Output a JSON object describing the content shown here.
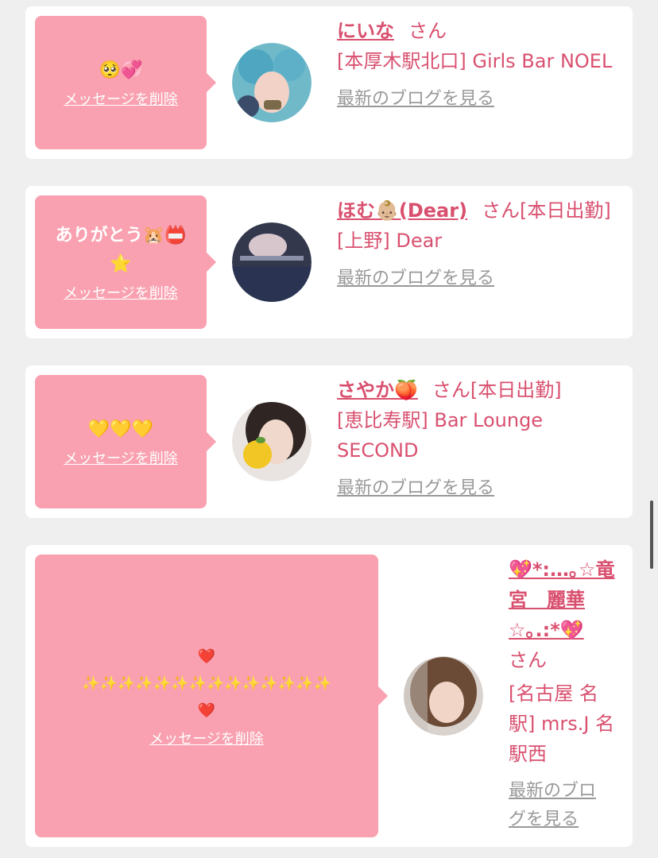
{
  "common": {
    "delete_label": "メッセージを削除",
    "blog_label": "最新のブログを見る",
    "blog_label_wrapped": "最新のブロ\nグを見る"
  },
  "cards": [
    {
      "message": "🥺💞",
      "name": "にいな",
      "suffix": "さん",
      "shop": "[本厚木駅北口] Girls Bar NOEL"
    },
    {
      "message": "ありがとう🐹📛\n⭐️",
      "name": "ほむ👶🏼(Dear)",
      "suffix": "さん[本日出勤]",
      "shop": "[上野] Dear"
    },
    {
      "message": "💛💛💛",
      "name": "さやか🍑",
      "suffix": "さん[本日出勤]",
      "shop": "[恵比寿駅] Bar Lounge SECOND"
    },
    {
      "message": "❤️\n✨✨✨✨✨✨✨✨✨✨✨✨✨✨\n❤️",
      "name": "💖*:…｡☆竜宮　麗華☆｡.:*💖",
      "suffix": "さん",
      "shop": "[名古屋 名駅] mrs.J 名駅西"
    }
  ],
  "colors": {
    "bubble": "#f9a1b0",
    "accent": "#d9506f",
    "link_gray": "#999999",
    "background": "#efefef"
  }
}
